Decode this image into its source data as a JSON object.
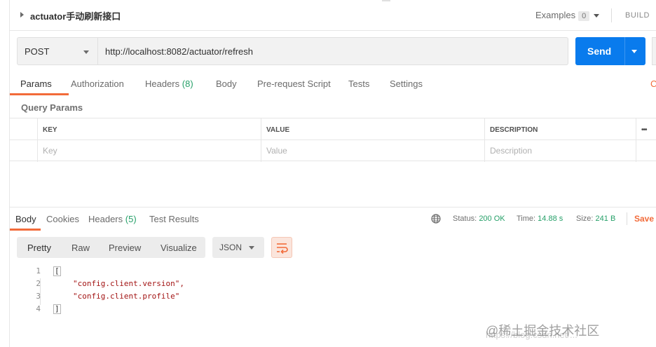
{
  "request": {
    "title": "actuator手动刷新接口",
    "examples_label": "Examples",
    "examples_count": "0",
    "build_label": "BUILD",
    "method": "POST",
    "url": "http://localhost:8082/actuator/refresh",
    "send_label": "Send"
  },
  "request_tabs": {
    "params": "Params",
    "authorization": "Authorization",
    "headers": "Headers",
    "headers_count": "(8)",
    "body": "Body",
    "prerequest": "Pre-request Script",
    "tests": "Tests",
    "settings": "Settings",
    "cookies_cut": "C"
  },
  "query_params": {
    "title": "Query Params",
    "columns": [
      "KEY",
      "VALUE",
      "DESCRIPTION"
    ],
    "placeholders": [
      "Key",
      "Value",
      "Description"
    ],
    "more": "•••"
  },
  "response": {
    "tabs": {
      "body": "Body",
      "cookies": "Cookies",
      "headers": "Headers",
      "headers_count": "(5)",
      "test_results": "Test Results"
    },
    "status_label": "Status:",
    "status_value": "200 OK",
    "time_label": "Time:",
    "time_value": "14.88 s",
    "size_label": "Size:",
    "size_value": "241 B",
    "save_label": "Save",
    "format_tabs": [
      "Pretty",
      "Raw",
      "Preview",
      "Visualize"
    ],
    "format_select": "JSON",
    "code_lines": [
      {
        "no": "1",
        "text": "["
      },
      {
        "no": "2",
        "text": "\"config.client.version\","
      },
      {
        "no": "3",
        "text": "\"config.client.profile\""
      },
      {
        "no": "4",
        "text": "]"
      }
    ]
  },
  "watermark": {
    "text": "@稀土掘金技术社区",
    "url": "https://blog.csdn.net/..."
  },
  "colors": {
    "accent": "#f26b3a",
    "send": "#097bed",
    "success": "#26a069"
  }
}
